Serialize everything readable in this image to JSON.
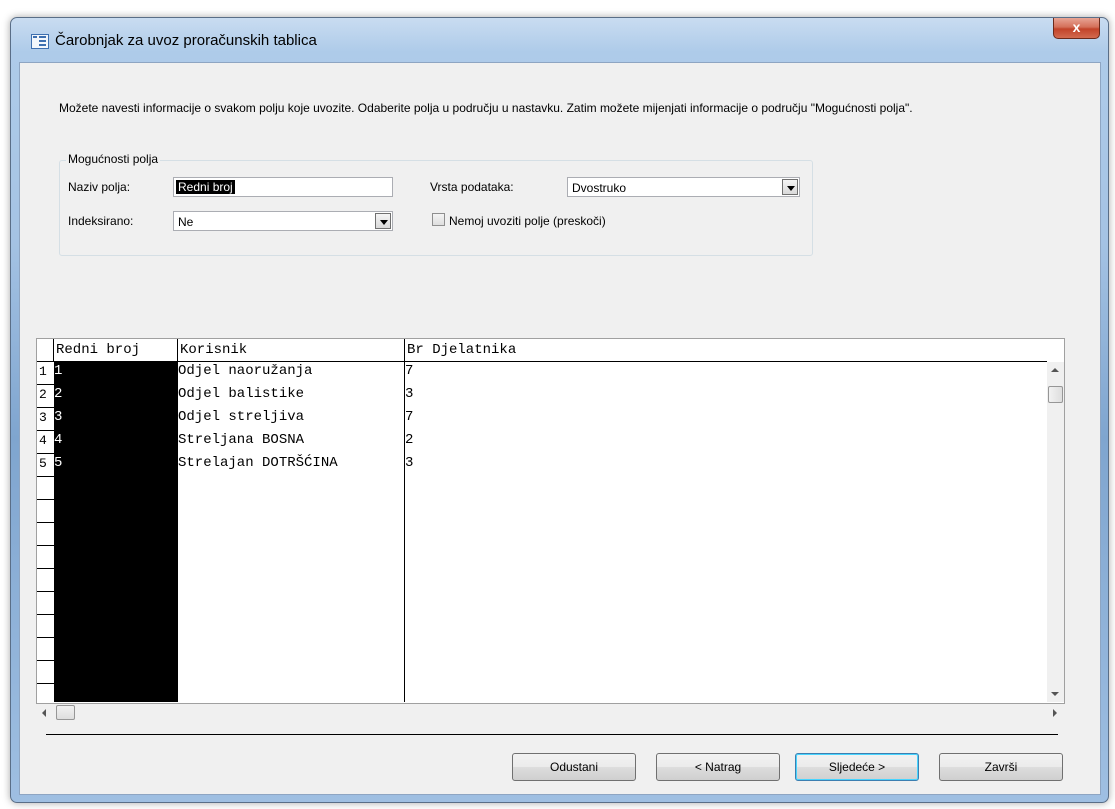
{
  "window": {
    "title": "Čarobnjak za uvoz proračunskih tablica",
    "close_glyph": "x"
  },
  "intro": {
    "text": "Možete navesti informacije o svakom polju koje uvozite. Odaberite polja u području u nastavku. Zatim možete mijenjati informacije o području \"Mogućnosti polja\"."
  },
  "field_options": {
    "legend": "Mogućnosti polja",
    "field_name_label": "Naziv polja:",
    "field_name_value": "Redni broj",
    "data_type_label": "Vrsta podataka:",
    "data_type_value": "Dvostruko",
    "indexed_label": "Indeksirano:",
    "indexed_value": "Ne",
    "skip_label": "Nemoj uvoziti polje (preskoči)",
    "skip_checked": false
  },
  "preview": {
    "columns": [
      "Redni broj",
      "Korisnik",
      "Br Djelatnika"
    ],
    "row_numbers": [
      "1",
      "2",
      "3",
      "4",
      "5"
    ],
    "rows": [
      [
        "1",
        "Odjel naoružanja",
        "7"
      ],
      [
        "2",
        "Odjel balistike",
        "3"
      ],
      [
        "3",
        "Odjel streljiva",
        "7"
      ],
      [
        "4",
        "Streljana BOSNA",
        "2"
      ],
      [
        "5",
        "Strelajan DOTRŠĆINA",
        "3"
      ]
    ],
    "selected_column": "Redni broj"
  },
  "buttons": {
    "cancel": "Odustani",
    "back": "< Natrag",
    "next": "Sljedeće >",
    "finish": "Završi"
  },
  "colors": {
    "selection": "#000000",
    "title_bar": "#aecbe9",
    "close_button": "#c2432a",
    "default_button_border": "#3c7fb1"
  }
}
